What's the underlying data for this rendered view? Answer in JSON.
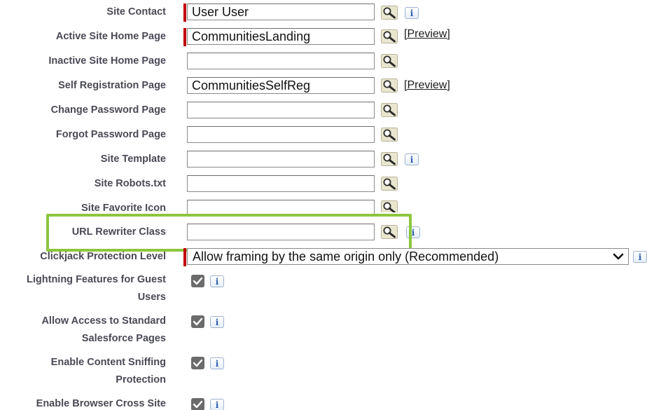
{
  "fields": {
    "site_contact": {
      "label": "Site Contact",
      "value": "User User"
    },
    "active_home": {
      "label": "Active Site Home Page",
      "value": "CommunitiesLanding",
      "preview": "[Preview]"
    },
    "inactive_home": {
      "label": "Inactive Site Home Page",
      "value": ""
    },
    "self_reg": {
      "label": "Self Registration Page",
      "value": "CommunitiesSelfReg",
      "preview": "[Preview]"
    },
    "change_pw": {
      "label": "Change Password Page",
      "value": ""
    },
    "forgot_pw": {
      "label": "Forgot Password Page",
      "value": ""
    },
    "site_template": {
      "label": "Site Template",
      "value": ""
    },
    "robots": {
      "label": "Site Robots.txt",
      "value": ""
    },
    "favicon": {
      "label": "Site Favorite Icon",
      "value": ""
    },
    "url_rewriter": {
      "label": "URL Rewriter Class",
      "value": ""
    },
    "clickjack": {
      "label": "Clickjack Protection Level",
      "selected": "Allow framing by the same origin only (Recommended)"
    },
    "lightning_guest": {
      "label_line1": "Lightning Features for Guest",
      "label_line2": "Users",
      "checked": true
    },
    "allow_std_pages": {
      "label_line1": "Allow Access to Standard",
      "label_line2": "Salesforce Pages",
      "checked": true
    },
    "content_sniff": {
      "label_line1": "Enable Content Sniffing",
      "label_line2": "Protection",
      "checked": true
    },
    "browser_xss": {
      "label_line1": "Enable Browser Cross Site",
      "checked": true
    }
  },
  "info_glyph": "i",
  "icons": {
    "lookup": "lookup-magnifier-icon",
    "info": "info-icon",
    "checkbox": "checkmark-icon",
    "chevron": "chevron-down-icon"
  },
  "colors": {
    "label": "#4a4a56",
    "required_bar": "#c00000",
    "highlight_box": "#8dc63f",
    "info_blue": "#2a5db0",
    "checkbox_fill": "#6b6b6b"
  }
}
